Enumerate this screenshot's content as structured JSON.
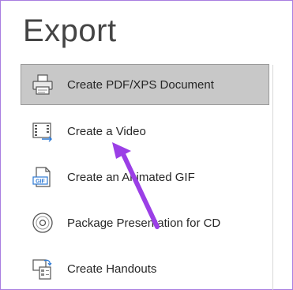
{
  "export": {
    "title": "Export",
    "items": [
      {
        "label": "Create PDF/XPS Document",
        "icon": "printer-icon",
        "selected": true
      },
      {
        "label": "Create a Video",
        "icon": "video-icon",
        "selected": false
      },
      {
        "label": "Create an Animated GIF",
        "icon": "gif-icon",
        "selected": false
      },
      {
        "label": "Package Presentation for CD",
        "icon": "cd-icon",
        "selected": false
      },
      {
        "label": "Create Handouts",
        "icon": "handouts-icon",
        "selected": false
      }
    ]
  },
  "colors": {
    "frame_border": "#a97ee0",
    "selected_bg": "#c8c8c8",
    "annotation_arrow": "#9b3fe6"
  }
}
